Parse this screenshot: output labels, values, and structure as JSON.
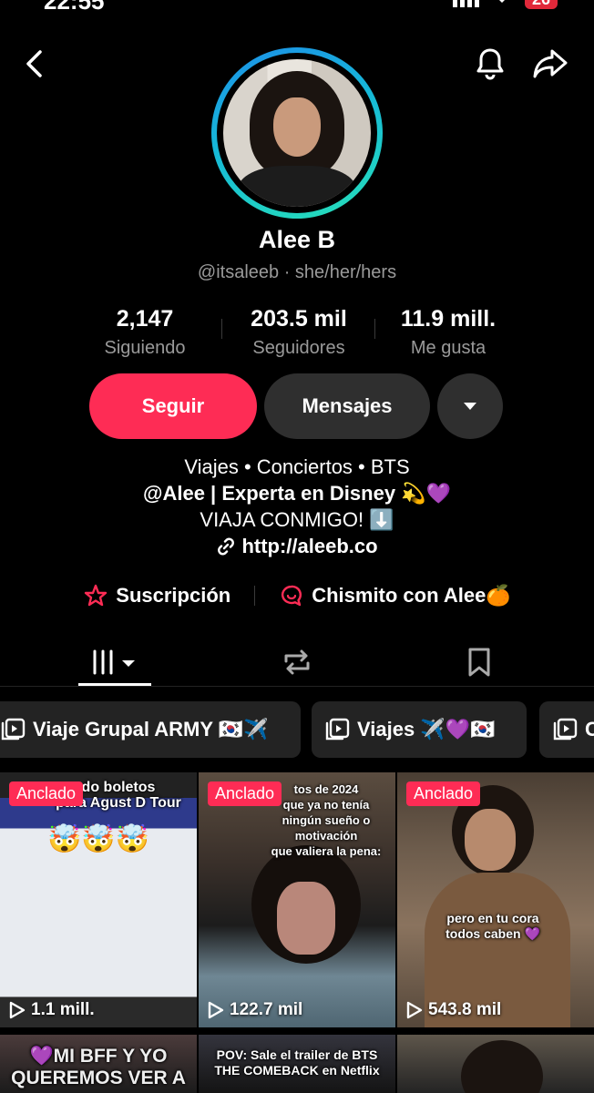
{
  "status": {
    "time": "22:55",
    "battery": "26"
  },
  "profile": {
    "name": "Alee B",
    "handle": "@itsaleeb · she/her/hers"
  },
  "stats": [
    {
      "value": "2,147",
      "label": "Siguiendo"
    },
    {
      "value": "203.5 mil",
      "label": "Seguidores"
    },
    {
      "value": "11.9 mill.",
      "label": "Me gusta"
    }
  ],
  "actions": {
    "follow": "Seguir",
    "message": "Mensajes"
  },
  "bio": {
    "line1": "Viajes • Conciertos • BTS",
    "line2": "@Alee | Experta en Disney 💫💜",
    "line3": "VIAJA CONMIGO! ⬇️",
    "link": "http://aleeb.co"
  },
  "chips": [
    {
      "label": "Suscripción",
      "icon": "star-badge-icon"
    },
    {
      "label": "Chismito con Alee🍊",
      "icon": "chat-bubble-icon"
    }
  ],
  "tabs": [
    {
      "name": "videos-grid",
      "icon": "grid-icon"
    },
    {
      "name": "reposts",
      "icon": "repost-icon"
    },
    {
      "name": "favorites",
      "icon": "bookmark-icon"
    }
  ],
  "playlists": [
    {
      "label": "Viaje Grupal ARMY 🇰🇷✈️"
    },
    {
      "label": "Viajes ✈️💜🇰🇷"
    },
    {
      "label": "C"
    }
  ],
  "videos": [
    {
      "pinned": "Anclado",
      "views": "1.1 mill.",
      "caption": "do boletos\npara Agust D Tour",
      "colors": [
        "#3a3f52",
        "#dfe3ea"
      ]
    },
    {
      "pinned": "Anclado",
      "views": "122.7 mil",
      "caption": "tos de 2024\nque ya no tenía\nningún sueño o motivación\nque valiera la pena:",
      "colors": [
        "#6b5a4a",
        "#2a2a2a"
      ]
    },
    {
      "pinned": "Anclado",
      "views": "543.8 mil",
      "caption": "pero en tu cora\ntodos caben 💜",
      "colors": [
        "#5a4b3c",
        "#8a7460"
      ]
    },
    {
      "pinned": "",
      "views": "",
      "caption": "💜MI BFF Y YO\nQUEREMOS VER A",
      "colors": [
        "#3d3030",
        "#1a1a1a"
      ]
    },
    {
      "pinned": "",
      "views": "",
      "caption": "POV: Sale el trailer de BTS\nTHE COMEBACK en Netflix",
      "colors": [
        "#2c2c34",
        "#111"
      ]
    },
    {
      "pinned": "",
      "views": "",
      "caption": "",
      "colors": [
        "#5a5248",
        "#222"
      ]
    }
  ],
  "labels": {
    "pinned_tag": "Anclado"
  }
}
